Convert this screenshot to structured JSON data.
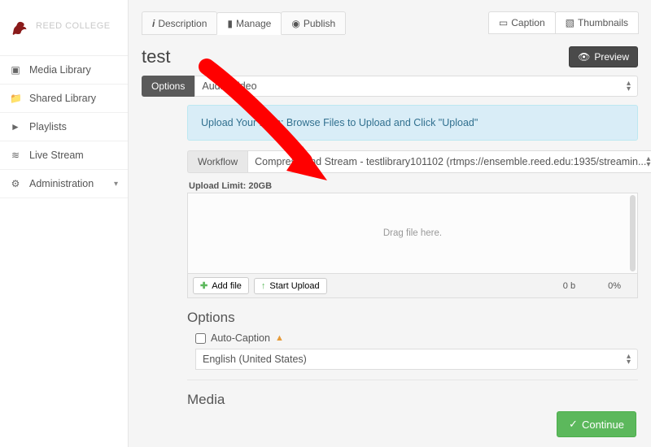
{
  "brand": {
    "name": "REED COLLEGE"
  },
  "sidebar": {
    "items": [
      {
        "label": "Media Library"
      },
      {
        "label": "Shared Library"
      },
      {
        "label": "Playlists"
      },
      {
        "label": "Live Stream"
      },
      {
        "label": "Administration"
      }
    ]
  },
  "tabs": {
    "description": "Description",
    "manage": "Manage",
    "publish": "Publish",
    "caption": "Caption",
    "thumbnails": "Thumbnails"
  },
  "page": {
    "title": "test",
    "preview": "Preview"
  },
  "options_field": {
    "label": "Options",
    "value": "Audio/Video"
  },
  "upload": {
    "banner": "Upload Your Files: Browse Files to Upload and Click \"Upload\"",
    "workflow_label": "Workflow",
    "workflow_value": "Compress And Stream - testlibrary101102 (rtmps://ensemble.reed.edu:1935/streamin...",
    "limit_label": "Upload Limit: 20GB",
    "dropzone": "Drag file here.",
    "add_file": "Add file",
    "start_upload": "Start Upload",
    "size": "0 b",
    "pct": "0%"
  },
  "options_section": {
    "heading": "Options",
    "auto_caption": "Auto-Caption",
    "language": "English (United States)"
  },
  "media_section": {
    "heading": "Media"
  },
  "footer": {
    "continue": "Continue"
  }
}
